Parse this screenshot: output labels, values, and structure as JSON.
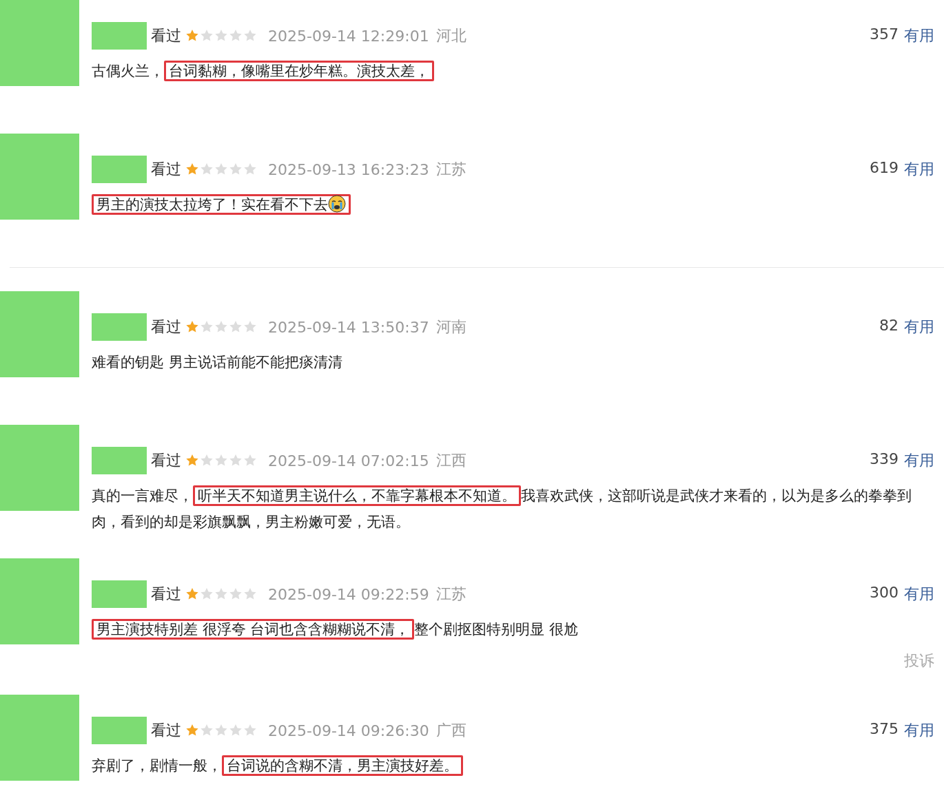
{
  "comments": [
    {
      "status": "看过",
      "stars": 1,
      "time": "2025-09-14 12:29:01",
      "location": "河北",
      "votes": "357",
      "votes_label": "有用",
      "divider_below": false,
      "segments": [
        {
          "text": "古偶火兰，",
          "highlighted": false,
          "emoji": false
        },
        {
          "text": "台词黏糊，像嘴里在炒年糕。演技太差，",
          "highlighted": true,
          "emoji": false
        }
      ]
    },
    {
      "status": "看过",
      "stars": 1,
      "time": "2025-09-13 16:23:23",
      "location": "江苏",
      "votes": "619",
      "votes_label": "有用",
      "divider_below": true,
      "segments": [
        {
          "text": "男主的演技太拉垮了！实在看不下去",
          "highlighted": true,
          "emoji": true
        }
      ]
    },
    {
      "status": "看过",
      "stars": 1,
      "time": "2025-09-14 13:50:37",
      "location": "河南",
      "votes": "82",
      "votes_label": "有用",
      "divider_below": false,
      "segments": [
        {
          "text": "难看的钥匙 男主说话前能不能把痰清清",
          "highlighted": false,
          "emoji": false
        }
      ]
    },
    {
      "status": "看过",
      "stars": 1,
      "time": "2025-09-14 07:02:15",
      "location": "江西",
      "votes": "339",
      "votes_label": "有用",
      "divider_below": false,
      "segments": [
        {
          "text": "真的一言难尽，",
          "highlighted": false,
          "emoji": false
        },
        {
          "text": "听半天不知道男主说什么，不靠字幕根本不知道。",
          "highlighted": true,
          "emoji": false
        },
        {
          "text": "我喜欢武侠，这部听说是武侠才来看的，以为是多么的拳拳到肉，看到的却是彩旗飘飘，男主粉嫩可爱，无语。",
          "highlighted": false,
          "emoji": false
        }
      ]
    },
    {
      "status": "看过",
      "stars": 1,
      "time": "2025-09-14 09:22:59",
      "location": "江苏",
      "votes": "300",
      "votes_label": "有用",
      "divider_below": false,
      "report": "投诉",
      "segments": [
        {
          "text": "男主演技特别差 很浮夸 台词也含含糊糊说不清，",
          "highlighted": true,
          "emoji": false
        },
        {
          "text": "整个剧抠图特别明显 很尬",
          "highlighted": false,
          "emoji": false
        }
      ]
    },
    {
      "status": "看过",
      "stars": 1,
      "time": "2025-09-14 09:26:30",
      "location": "广西",
      "votes": "375",
      "votes_label": "有用",
      "divider_below": false,
      "segments": [
        {
          "text": "弃剧了，剧情一般，",
          "highlighted": false,
          "emoji": false
        },
        {
          "text": "台词说的含糊不清，男主演技好差。",
          "highlighted": true,
          "emoji": false
        }
      ]
    }
  ]
}
